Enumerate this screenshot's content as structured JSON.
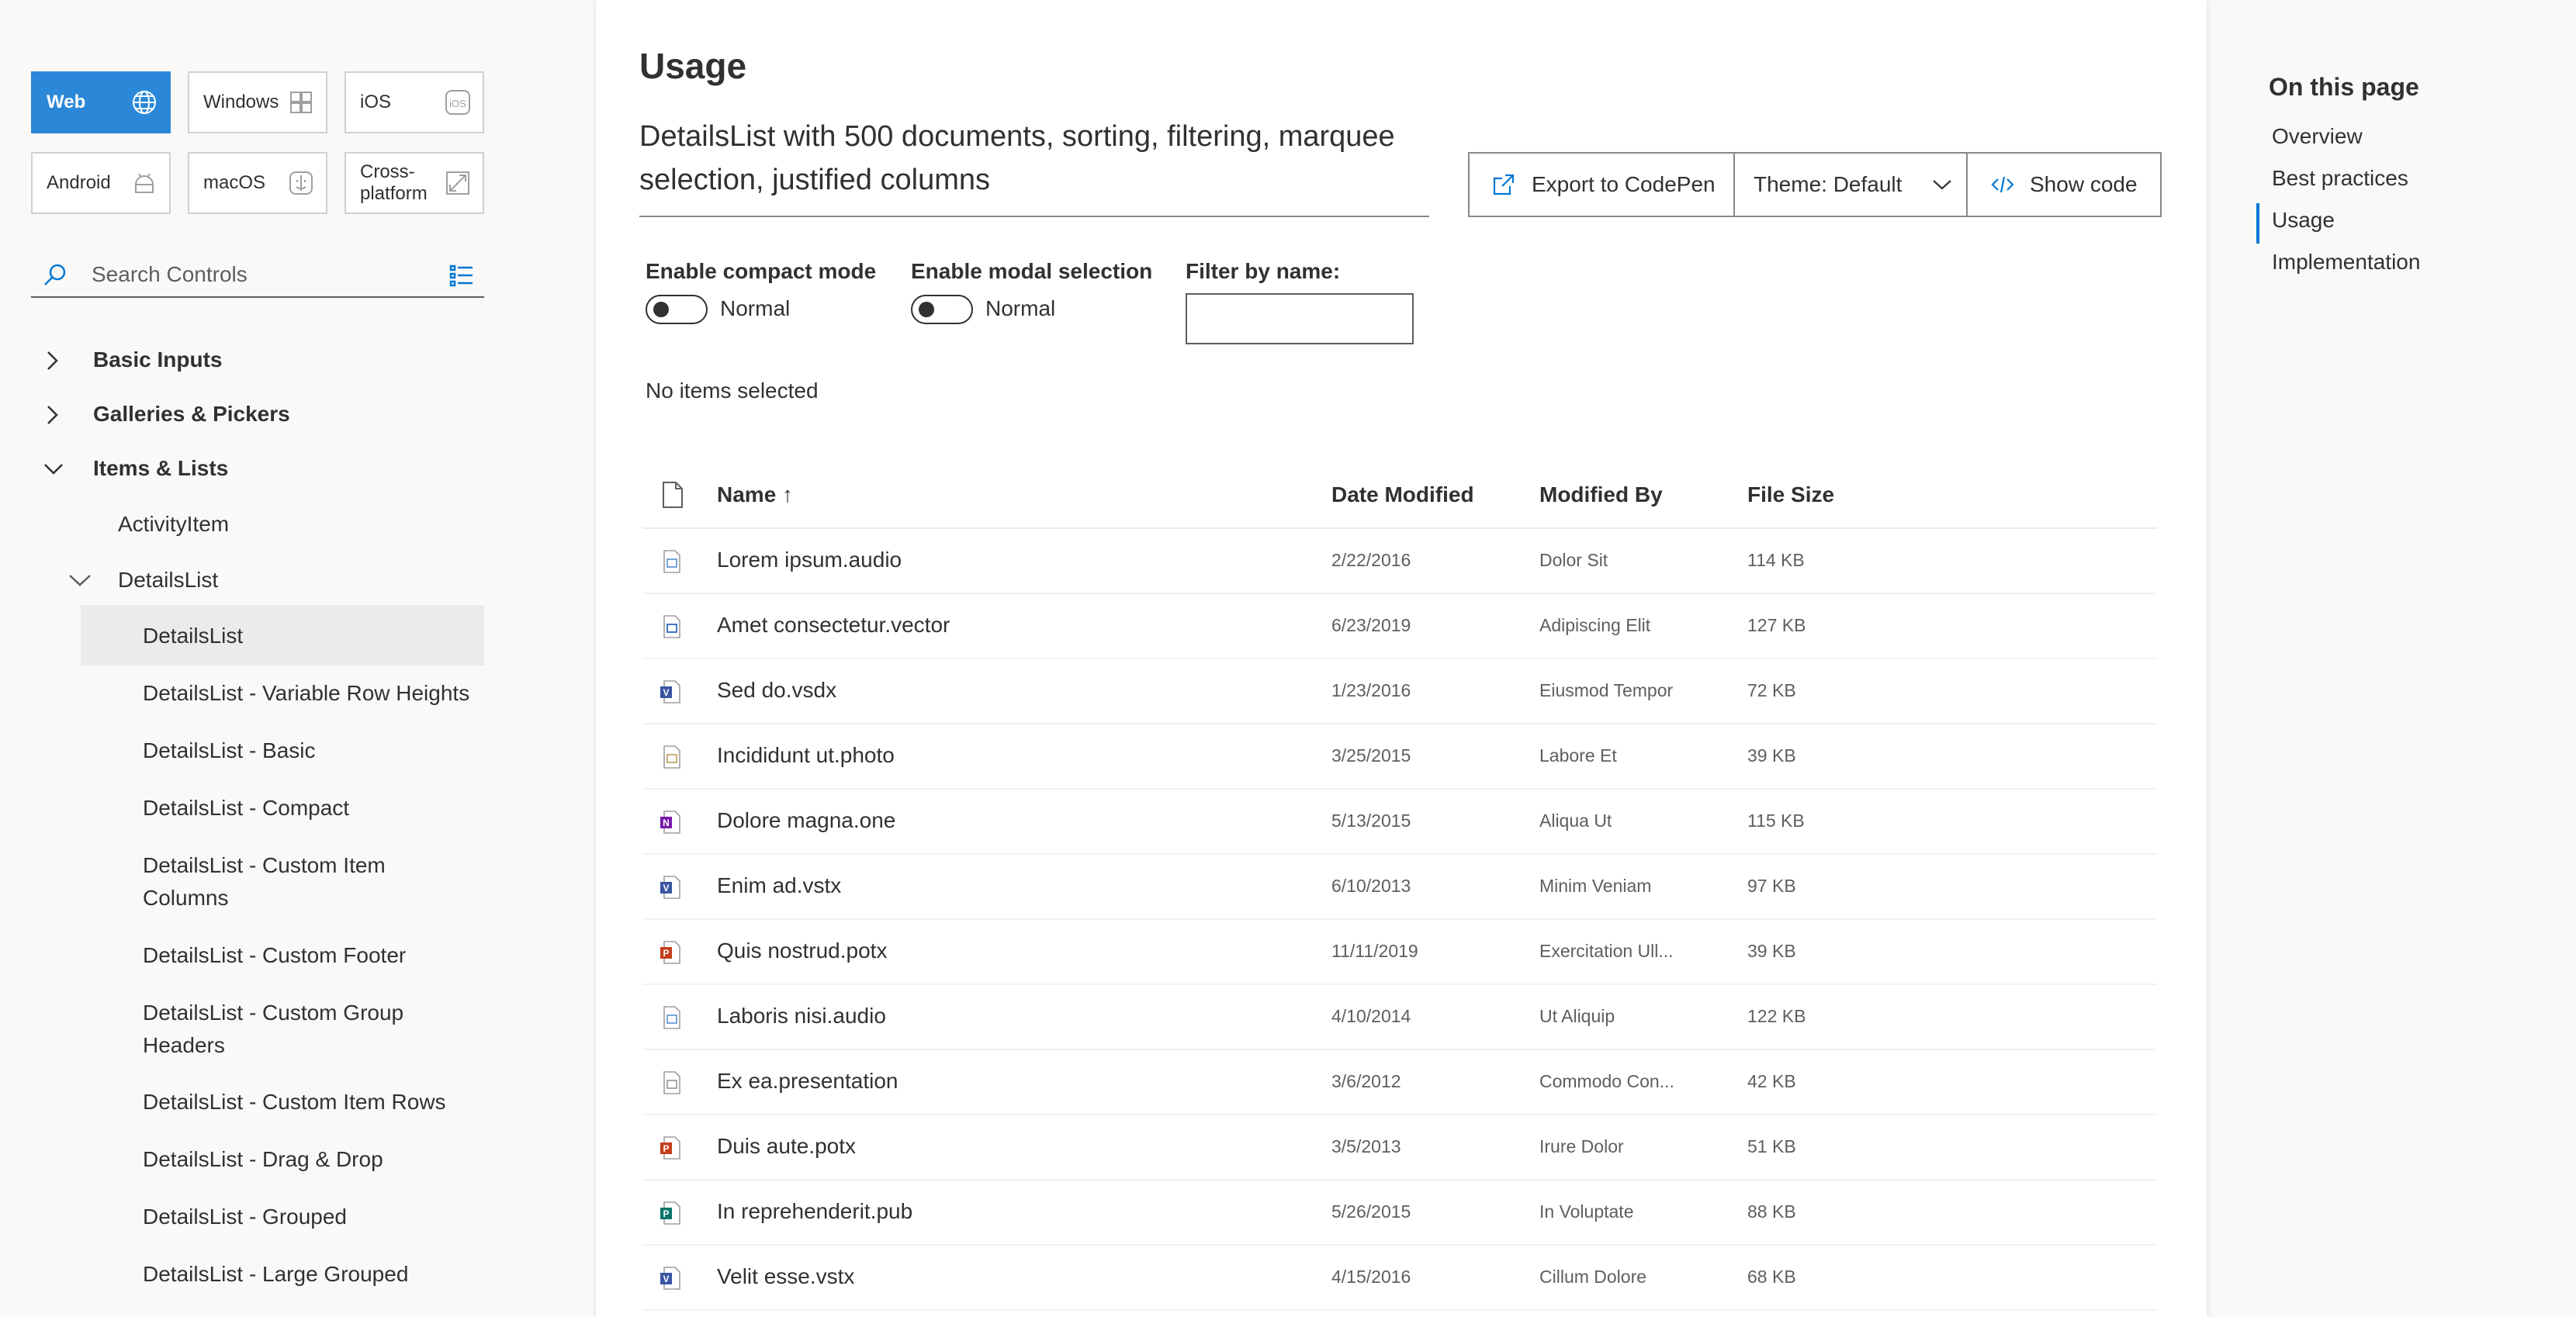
{
  "platforms": [
    {
      "label": "Web",
      "icon": "globe-icon",
      "active": true
    },
    {
      "label": "Windows",
      "icon": "windows-icon"
    },
    {
      "label": "iOS",
      "icon": "ios-icon"
    },
    {
      "label": "Android",
      "icon": "android-icon"
    },
    {
      "label": "macOS",
      "icon": "macos-icon"
    },
    {
      "label": "Cross-\nplatform",
      "icon": "cross-platform-icon"
    }
  ],
  "search": {
    "placeholder": "Search Controls"
  },
  "nav": {
    "groups": [
      "Basic Inputs",
      "Galleries & Pickers",
      "Items & Lists"
    ],
    "items": {
      "activity": "ActivityItem",
      "detailslist_parent": "DetailsList",
      "children": [
        "DetailsList",
        "DetailsList - Variable Row Heights",
        "DetailsList - Basic",
        "DetailsList - Compact",
        "DetailsList - Custom Item Columns",
        "DetailsList - Custom Footer",
        "DetailsList - Custom Group Headers",
        "DetailsList - Custom Item Rows",
        "DetailsList - Drag & Drop",
        "DetailsList - Grouped",
        "DetailsList - Large Grouped"
      ]
    }
  },
  "main": {
    "heading": "Usage",
    "example_title": "DetailsList with 500 documents, sorting, filtering, marquee selection, justified columns",
    "export_label": "Export to CodePen",
    "theme_label": "Theme: Default",
    "show_code_label": "Show code",
    "compact_label": "Enable compact mode",
    "compact_state": "Normal",
    "modal_label": "Enable modal selection",
    "modal_state": "Normal",
    "filter_label": "Filter by name:",
    "selection_status": "No items selected"
  },
  "list": {
    "columns": {
      "name": "Name ↑",
      "date": "Date Modified",
      "by": "Modified By",
      "size": "File Size"
    },
    "rows": [
      {
        "name": "Lorem ipsum.audio",
        "date": "2/22/2016",
        "by": "Dolor Sit",
        "size": "114 KB",
        "type": "audio",
        "color": "#6a9bd8"
      },
      {
        "name": "Amet consectetur.vector",
        "date": "6/23/2019",
        "by": "Adipiscing Elit",
        "size": "127 KB",
        "type": "vector",
        "color": "#2b6cc4"
      },
      {
        "name": "Sed do.vsdx",
        "date": "1/23/2016",
        "by": "Eiusmod Tempor",
        "size": "72 KB",
        "type": "visio",
        "color": "#3955a3"
      },
      {
        "name": "Incididunt ut.photo",
        "date": "3/25/2015",
        "by": "Labore Et",
        "size": "39 KB",
        "type": "photo",
        "color": "#c8a86a"
      },
      {
        "name": "Dolore magna.one",
        "date": "5/13/2015",
        "by": "Aliqua Ut",
        "size": "115 KB",
        "type": "onenote",
        "color": "#7719aa"
      },
      {
        "name": "Enim ad.vstx",
        "date": "6/10/2013",
        "by": "Minim Veniam",
        "size": "97 KB",
        "type": "visio",
        "color": "#3955a3"
      },
      {
        "name": "Quis nostrud.potx",
        "date": "11/11/2019",
        "by": "Exercitation Ull...",
        "size": "39 KB",
        "type": "powerpoint",
        "color": "#c43e1c"
      },
      {
        "name": "Laboris nisi.audio",
        "date": "4/10/2014",
        "by": "Ut Aliquip",
        "size": "122 KB",
        "type": "audio",
        "color": "#6a9bd8"
      },
      {
        "name": "Ex ea.presentation",
        "date": "3/6/2012",
        "by": "Commodo Con...",
        "size": "42 KB",
        "type": "presentation",
        "color": "#a19f9d"
      },
      {
        "name": "Duis aute.potx",
        "date": "3/5/2013",
        "by": "Irure Dolor",
        "size": "51 KB",
        "type": "powerpoint",
        "color": "#c43e1c"
      },
      {
        "name": "In reprehenderit.pub",
        "date": "5/26/2015",
        "by": "In Voluptate",
        "size": "88 KB",
        "type": "publisher",
        "color": "#077568"
      },
      {
        "name": "Velit esse.vstx",
        "date": "4/15/2016",
        "by": "Cillum Dolore",
        "size": "68 KB",
        "type": "visio",
        "color": "#3955a3"
      }
    ]
  },
  "toc": {
    "title": "On this page",
    "items": [
      "Overview",
      "Best practices",
      "Usage",
      "Implementation"
    ],
    "active_index": 2
  },
  "colors": {
    "accent": "#0078d4",
    "active_platform": "#2b88d8",
    "nav_selected": "#edebe9"
  }
}
